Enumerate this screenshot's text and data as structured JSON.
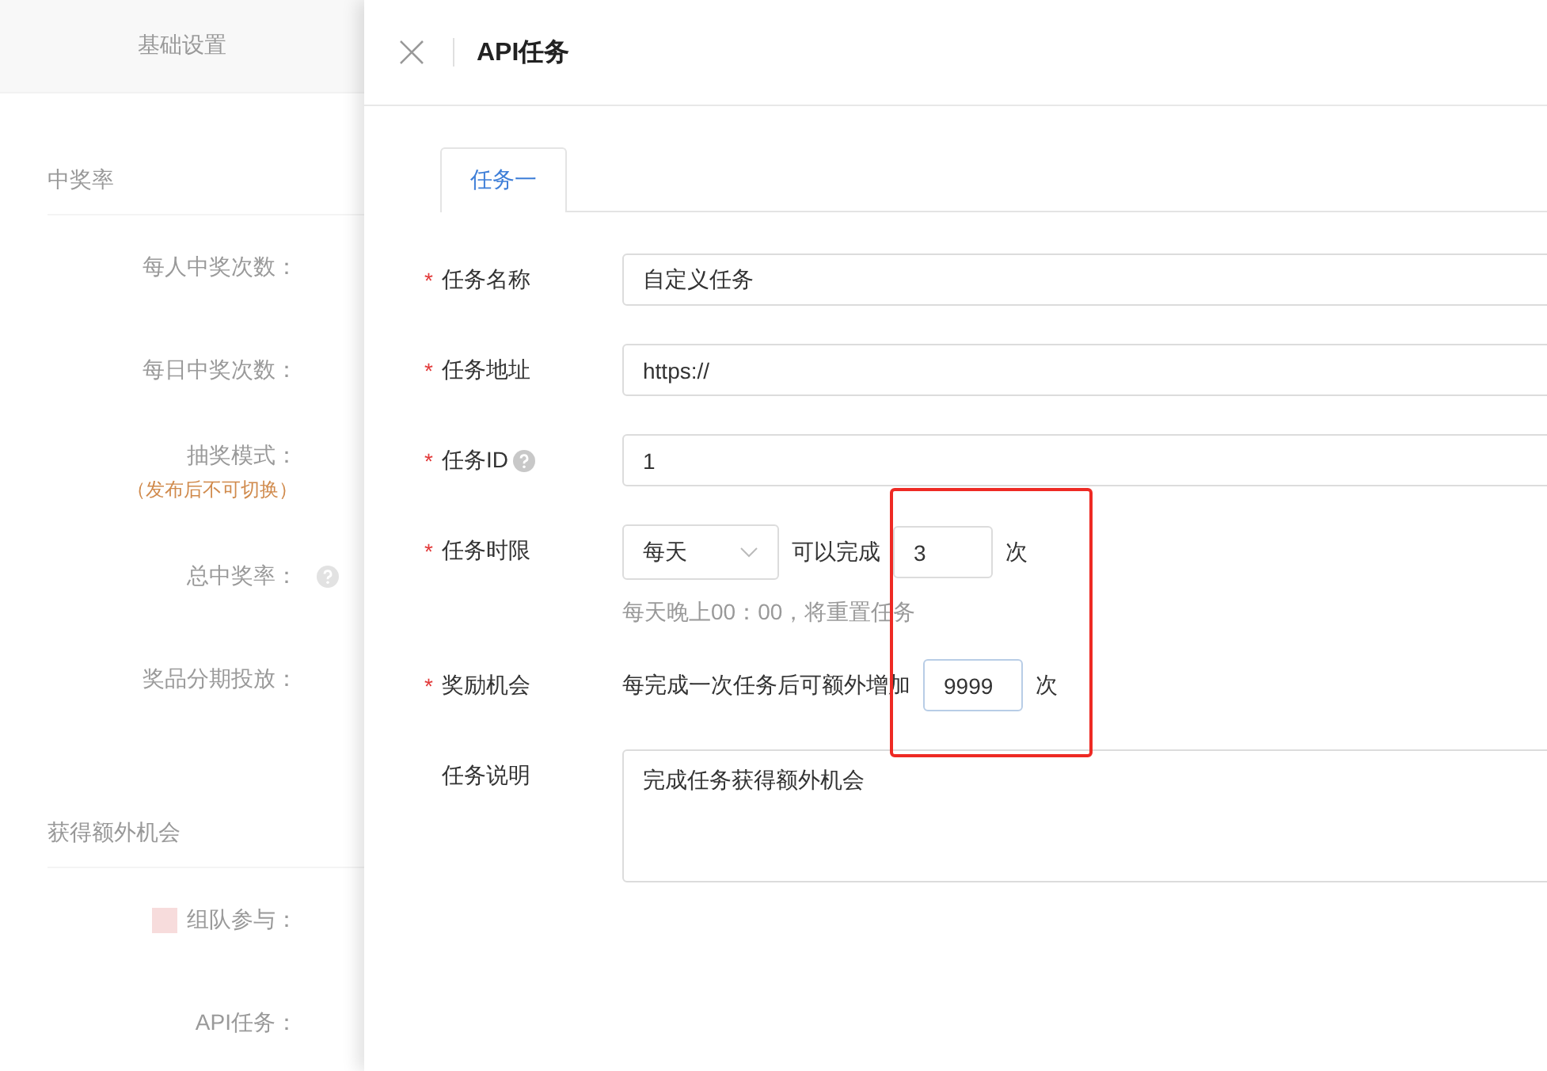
{
  "background": {
    "tab": "基础设置",
    "sections": [
      {
        "title": "中奖率",
        "fields": [
          {
            "label": "每人中奖次数：",
            "help": false,
            "marker": false
          },
          {
            "label": "每日中奖次数：",
            "help": false,
            "marker": false
          },
          {
            "label": "抽奖模式：",
            "note": "（发布后不可切换）",
            "help": false,
            "marker": false
          },
          {
            "label": "总中奖率：",
            "help": true,
            "marker": false
          },
          {
            "label": "奖品分期投放：",
            "help": false,
            "marker": false
          }
        ]
      },
      {
        "title": "获得额外机会",
        "fields": [
          {
            "label": "组队参与：",
            "help": false,
            "marker": true
          },
          {
            "label": "API任务：",
            "help": false,
            "marker": false
          }
        ]
      }
    ]
  },
  "drawer": {
    "title": "API任务",
    "tabs": [
      {
        "label": "任务一",
        "selected": true
      }
    ],
    "fields": [
      {
        "kind": "text",
        "label": "任务名称",
        "mark": "*",
        "help": false,
        "value": "自定义任务"
      },
      {
        "kind": "text",
        "label": "任务地址",
        "mark": "*",
        "help": false,
        "value": "https://"
      },
      {
        "kind": "text",
        "label": "任务ID",
        "mark": "*",
        "help": true,
        "value": "1"
      },
      {
        "kind": "period",
        "label": "任务时限",
        "mark": "*",
        "help": false,
        "select": "每天",
        "text": "可以完成",
        "count": "3",
        "unit": "次",
        "hint": "每天晚上00：00，将重置任务"
      },
      {
        "kind": "reward",
        "label": "奖励机会",
        "mark": "*",
        "help": false,
        "text": "每完成一次任务后可额外增加",
        "count": "9999",
        "unit": "次"
      },
      {
        "kind": "textarea",
        "label": "任务说明",
        "help": false,
        "value": "完成任务获得额外机会"
      }
    ]
  }
}
